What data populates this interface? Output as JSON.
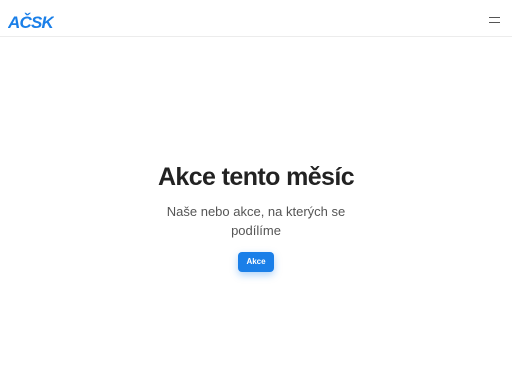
{
  "header": {
    "logo_text": "AČSK",
    "logo_color": "#1a7fe8",
    "menu_icon": "hamburger-menu-icon"
  },
  "hero": {
    "title": "Akce tento měsíc",
    "subtitle": "Naše nebo akce, na kterých se podílíme",
    "button_label": "Akce",
    "button_color": "#1a7fe8"
  }
}
